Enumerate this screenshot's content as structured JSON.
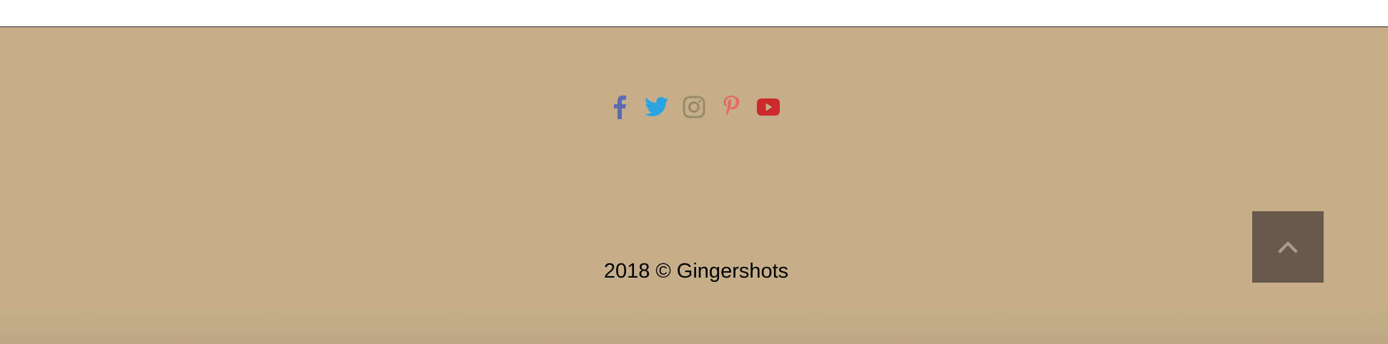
{
  "footer": {
    "social_links": [
      {
        "icon": "facebook-icon",
        "label": "Facebook",
        "color": "#5a6bb4"
      },
      {
        "icon": "twitter-icon",
        "label": "Twitter",
        "color": "#2aa3e0"
      },
      {
        "icon": "instagram-icon",
        "label": "Instagram",
        "color": "#978a65"
      },
      {
        "icon": "pinterest-icon",
        "label": "Pinterest",
        "color": "#e86a5e"
      },
      {
        "icon": "youtube-icon",
        "label": "YouTube",
        "color": "#cc2a2a"
      }
    ],
    "copyright": "2018 © Gingershots",
    "back_to_top_icon": "chevron-up-icon",
    "background_color": "#c5ae89",
    "back_to_top_color": "#675a4c"
  }
}
